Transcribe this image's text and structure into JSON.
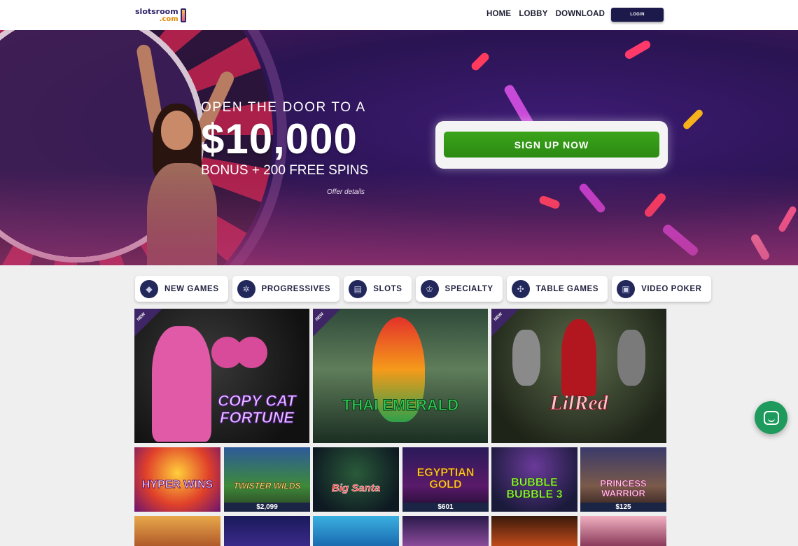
{
  "header": {
    "logo_text": "slotsroom",
    "logo_sub": ".com",
    "nav": [
      "HOME",
      "LOBBY",
      "DOWNLOAD"
    ],
    "login_label": "LOGIN"
  },
  "hero": {
    "line1": "OPEN THE DOOR TO A",
    "amount": "$10,000",
    "line3": "BONUS + 200 FREE SPINS",
    "offer_details": "Offer details",
    "signup_label": "SIGN UP NOW"
  },
  "categories": [
    {
      "label": "NEW GAMES",
      "icon": "diamond-icon"
    },
    {
      "label": "PROGRESSIVES",
      "icon": "sparkle-icon"
    },
    {
      "label": "SLOTS",
      "icon": "slot-machine-icon"
    },
    {
      "label": "SPECIALTY",
      "icon": "crown-icon"
    },
    {
      "label": "TABLE GAMES",
      "icon": "chips-icon"
    },
    {
      "label": "VIDEO POKER",
      "icon": "cards-icon"
    }
  ],
  "featured_games": [
    {
      "title": "COPY CAT FORTUNE",
      "badge": "NEW"
    },
    {
      "title": "THAI EMERALD",
      "badge": "NEW"
    },
    {
      "title": "LilRed",
      "badge": "NEW"
    }
  ],
  "games": [
    {
      "title": "HYPER WINS",
      "jackpot": ""
    },
    {
      "title": "TWISTER WILDS",
      "jackpot": "$2,099"
    },
    {
      "title": "Big Santa",
      "jackpot": ""
    },
    {
      "title": "EGYPTIAN GOLD",
      "jackpot": "$601"
    },
    {
      "title": "BUBBLE BUBBLE 3",
      "jackpot": ""
    },
    {
      "title": "PRINCESS WARRIOR",
      "jackpot": "$125"
    }
  ],
  "colors": {
    "nav_dark": "#1c1a4a",
    "signup_green": "#2c8a12",
    "chat_green": "#1e9a5c",
    "category_icon_bg": "#23285a"
  }
}
